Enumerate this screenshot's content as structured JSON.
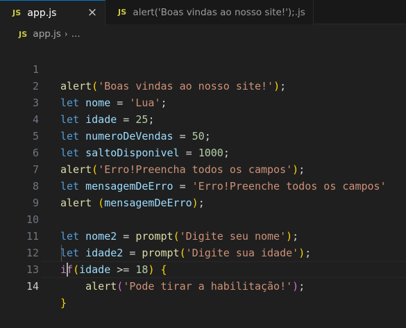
{
  "tabs": [
    {
      "icon": "JS",
      "label": "app.js",
      "active": true,
      "close": "×"
    },
    {
      "icon": "JS",
      "label": "alert('Boas vindas ao nosso site!');.js",
      "active": false
    }
  ],
  "breadcrumb": {
    "icon": "JS",
    "file": "app.js",
    "separator": "›",
    "more": "..."
  },
  "editor": {
    "current_line": 14,
    "lines": [
      {
        "n": "1"
      },
      {
        "n": "2"
      },
      {
        "n": "3"
      },
      {
        "n": "4"
      },
      {
        "n": "5"
      },
      {
        "n": "6"
      },
      {
        "n": "7"
      },
      {
        "n": "8"
      },
      {
        "n": "9"
      },
      {
        "n": "10"
      },
      {
        "n": "11"
      },
      {
        "n": "12"
      },
      {
        "n": "13"
      },
      {
        "n": "14"
      }
    ],
    "tokens": {
      "l1": [
        "alert",
        "(",
        "'Boas vindas ao nosso site!'",
        ")",
        ";"
      ],
      "l2": [
        "let",
        " nome",
        " = ",
        "'Lua'",
        ";"
      ],
      "l3": [
        "let",
        " idade",
        " = ",
        "25",
        ";"
      ],
      "l4": [
        "let",
        " numeroDeVendas",
        " = ",
        "50",
        ";"
      ],
      "l5": [
        "let",
        " saltoDisponivel",
        " = ",
        "1000",
        ";"
      ],
      "l6": [
        "alert",
        "(",
        "'Erro!Preencha todos os campos'",
        ")",
        ";"
      ],
      "l7": [
        "let",
        " mensagemDeErro",
        " = ",
        "'Erro!Preenche todos os campos'"
      ],
      "l8": [
        "alert",
        " (",
        "mensagemDeErro",
        ")",
        ";"
      ],
      "l10": [
        "let",
        " nome2",
        " = ",
        "prompt",
        "(",
        "'Digite seu nome'",
        ")",
        ";"
      ],
      "l11": [
        "let",
        " idade2",
        " = ",
        "prompt",
        "(",
        "'Digite sua idade'",
        ")",
        ";"
      ],
      "l12": [
        "if",
        "(",
        "idade",
        " >= ",
        "18",
        ")",
        " ",
        "{"
      ],
      "l13": [
        "    ",
        "alert",
        "(",
        "'Pode tirar a habilitação!'",
        ")",
        ";"
      ],
      "l14": [
        "}"
      ]
    }
  }
}
